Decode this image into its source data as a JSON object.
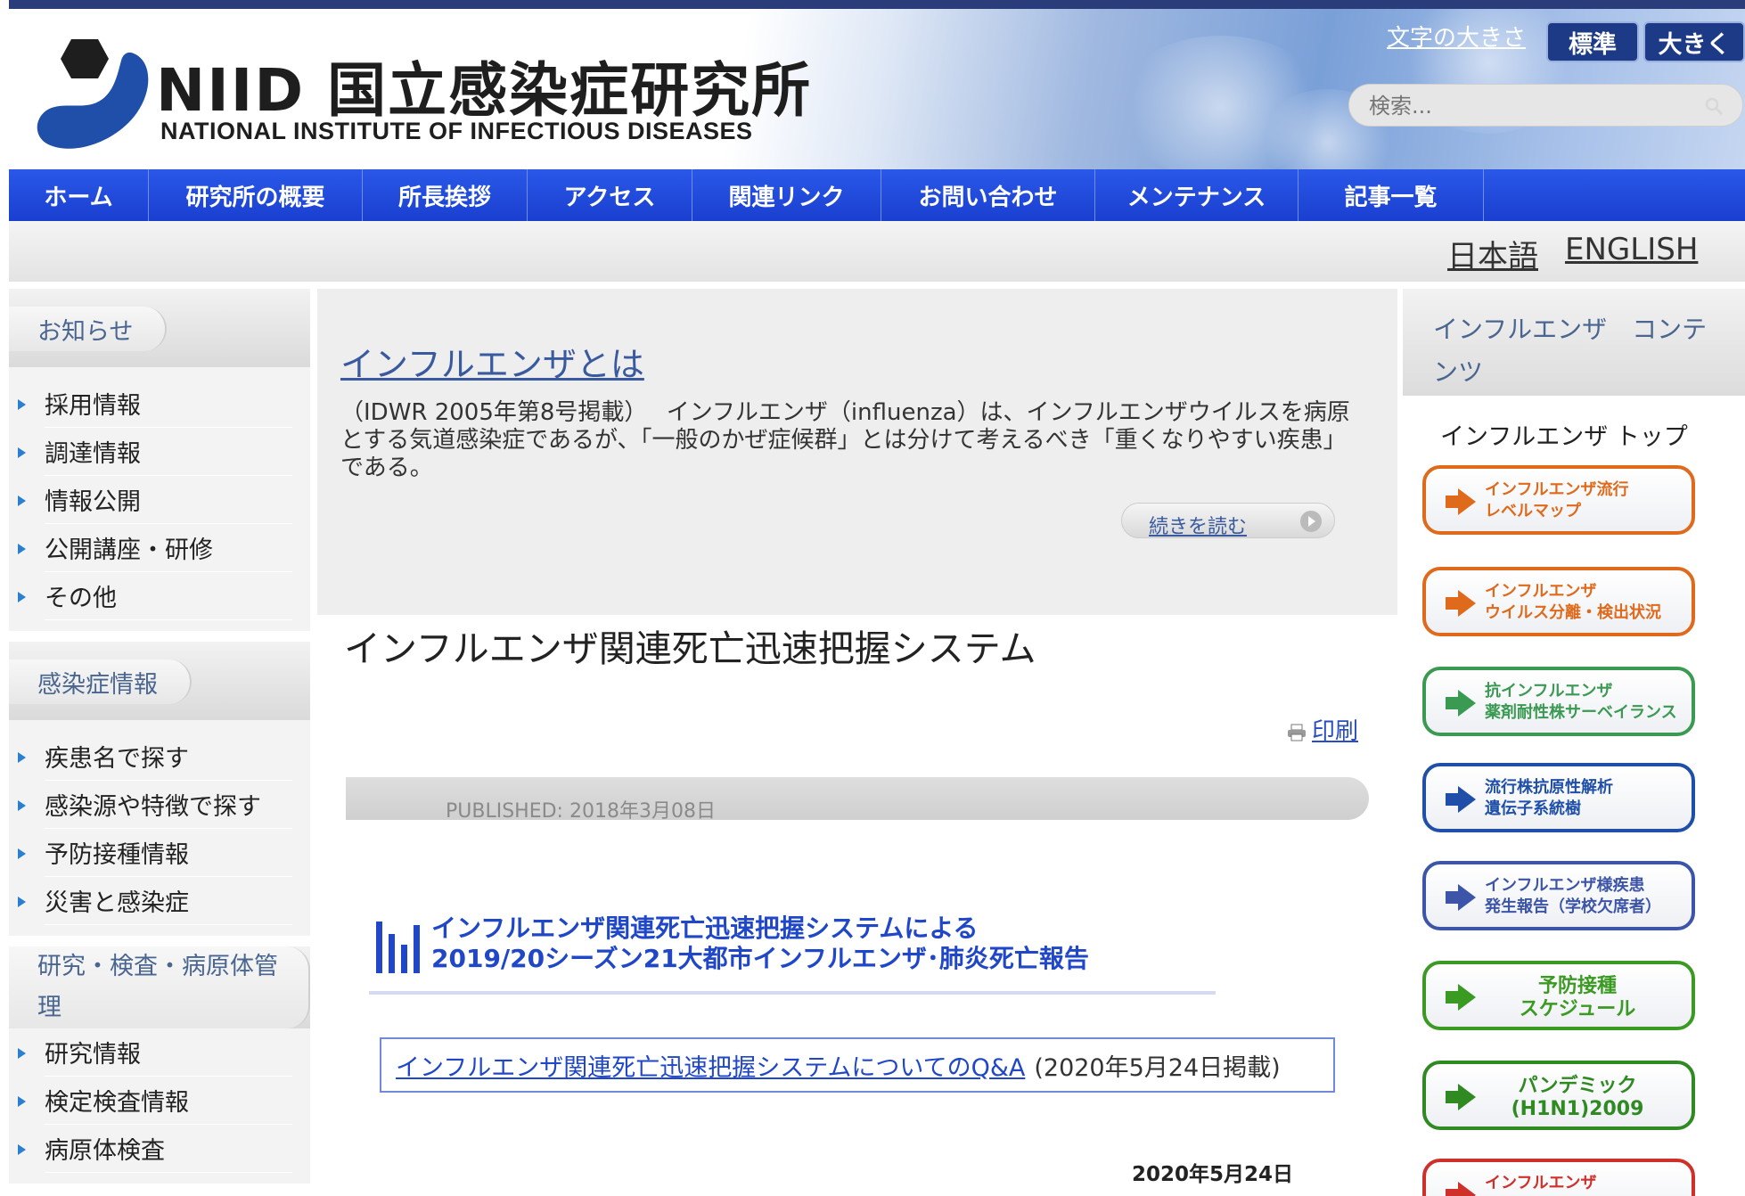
{
  "header": {
    "logo_ja": "NIID 国立感染症研究所",
    "logo_en": "NATIONAL INSTITUTE OF INFECTIOUS DISEASES",
    "font_size_label": "文字の大きさ",
    "font_standard": "標準",
    "font_large": "大きく",
    "search_placeholder": "検索..."
  },
  "nav": {
    "items": [
      "ホーム",
      "研究所の概要",
      "所長挨拶",
      "アクセス",
      "関連リンク",
      "お問い合わせ",
      "メンテナンス",
      "記事一覧"
    ]
  },
  "lang": {
    "ja": "日本語",
    "en": "ENGLISH"
  },
  "left_sidebar": {
    "news": {
      "title": "お知らせ",
      "items": [
        "採用情報",
        "調達情報",
        "情報公開",
        "公開講座・研修",
        "その他"
      ]
    },
    "infection": {
      "title": "感染症情報",
      "items": [
        "疾患名で探す",
        "感染源や特徴で探す",
        "予防接種情報",
        "災害と感染症"
      ]
    },
    "research": {
      "title": "研究・検査・病原体管理",
      "items": [
        "研究情報",
        "検定検査情報",
        "病原体検査"
      ]
    }
  },
  "intro": {
    "title": "インフルエンザとは",
    "text": "（IDWR 2005年第8号掲載）　 インフルエンザ（influenza）は、インフルエンザウイルスを病原とする気道感染症であるが、「一般のかぜ症候群」とは分けて考えるべき「重くなりやすい疾患」である。",
    "read_more": "続きを読む"
  },
  "article": {
    "title": "インフルエンザ関連死亡迅速把握システム",
    "print": "印刷",
    "published": "PUBLISHED: 2018年3月08日",
    "banner_line1": "インフルエンザ関連死亡迅速把握システムによる",
    "banner_line2": "2019/20シーズン21大都市インフルエンザ･肺炎死亡報告",
    "qa_link": "インフルエンザ関連死亡迅速把握システムについてのQ&A",
    "qa_date": "(2020年5月24日掲載)",
    "date": "2020年5月24日"
  },
  "right_sidebar": {
    "title": "インフルエンザ　コンテンツ",
    "top_link": "インフルエンザ トップ",
    "buttons": [
      {
        "label": "インフルエンザ流行\nレベルマップ",
        "color": "#e06a1c"
      },
      {
        "label": "インフルエンザ\nウイルス分離・検出状況",
        "color": "#e06a1c"
      },
      {
        "label": "抗インフルエンザ\n薬剤耐性株サーベイランス",
        "color": "#3a9a52"
      },
      {
        "label": "流行株抗原性解析\n遺伝子系統樹",
        "color": "#1f4fa8"
      },
      {
        "label": "インフルエンザ様疾患\n発生報告（学校欠席者）",
        "color": "#3d55a8"
      },
      {
        "label": "予防接種\nスケジュール",
        "color": "#3a9a22"
      },
      {
        "label": "パンデミック\n(H1N1)2009",
        "color": "#2f8a22"
      },
      {
        "label": "インフルエンザ",
        "color": "#d0302a"
      }
    ]
  },
  "colors": {
    "nav_blue": "#2a58e8",
    "link_blue": "#1f47c8",
    "sidebar_title": "#4a6690"
  }
}
